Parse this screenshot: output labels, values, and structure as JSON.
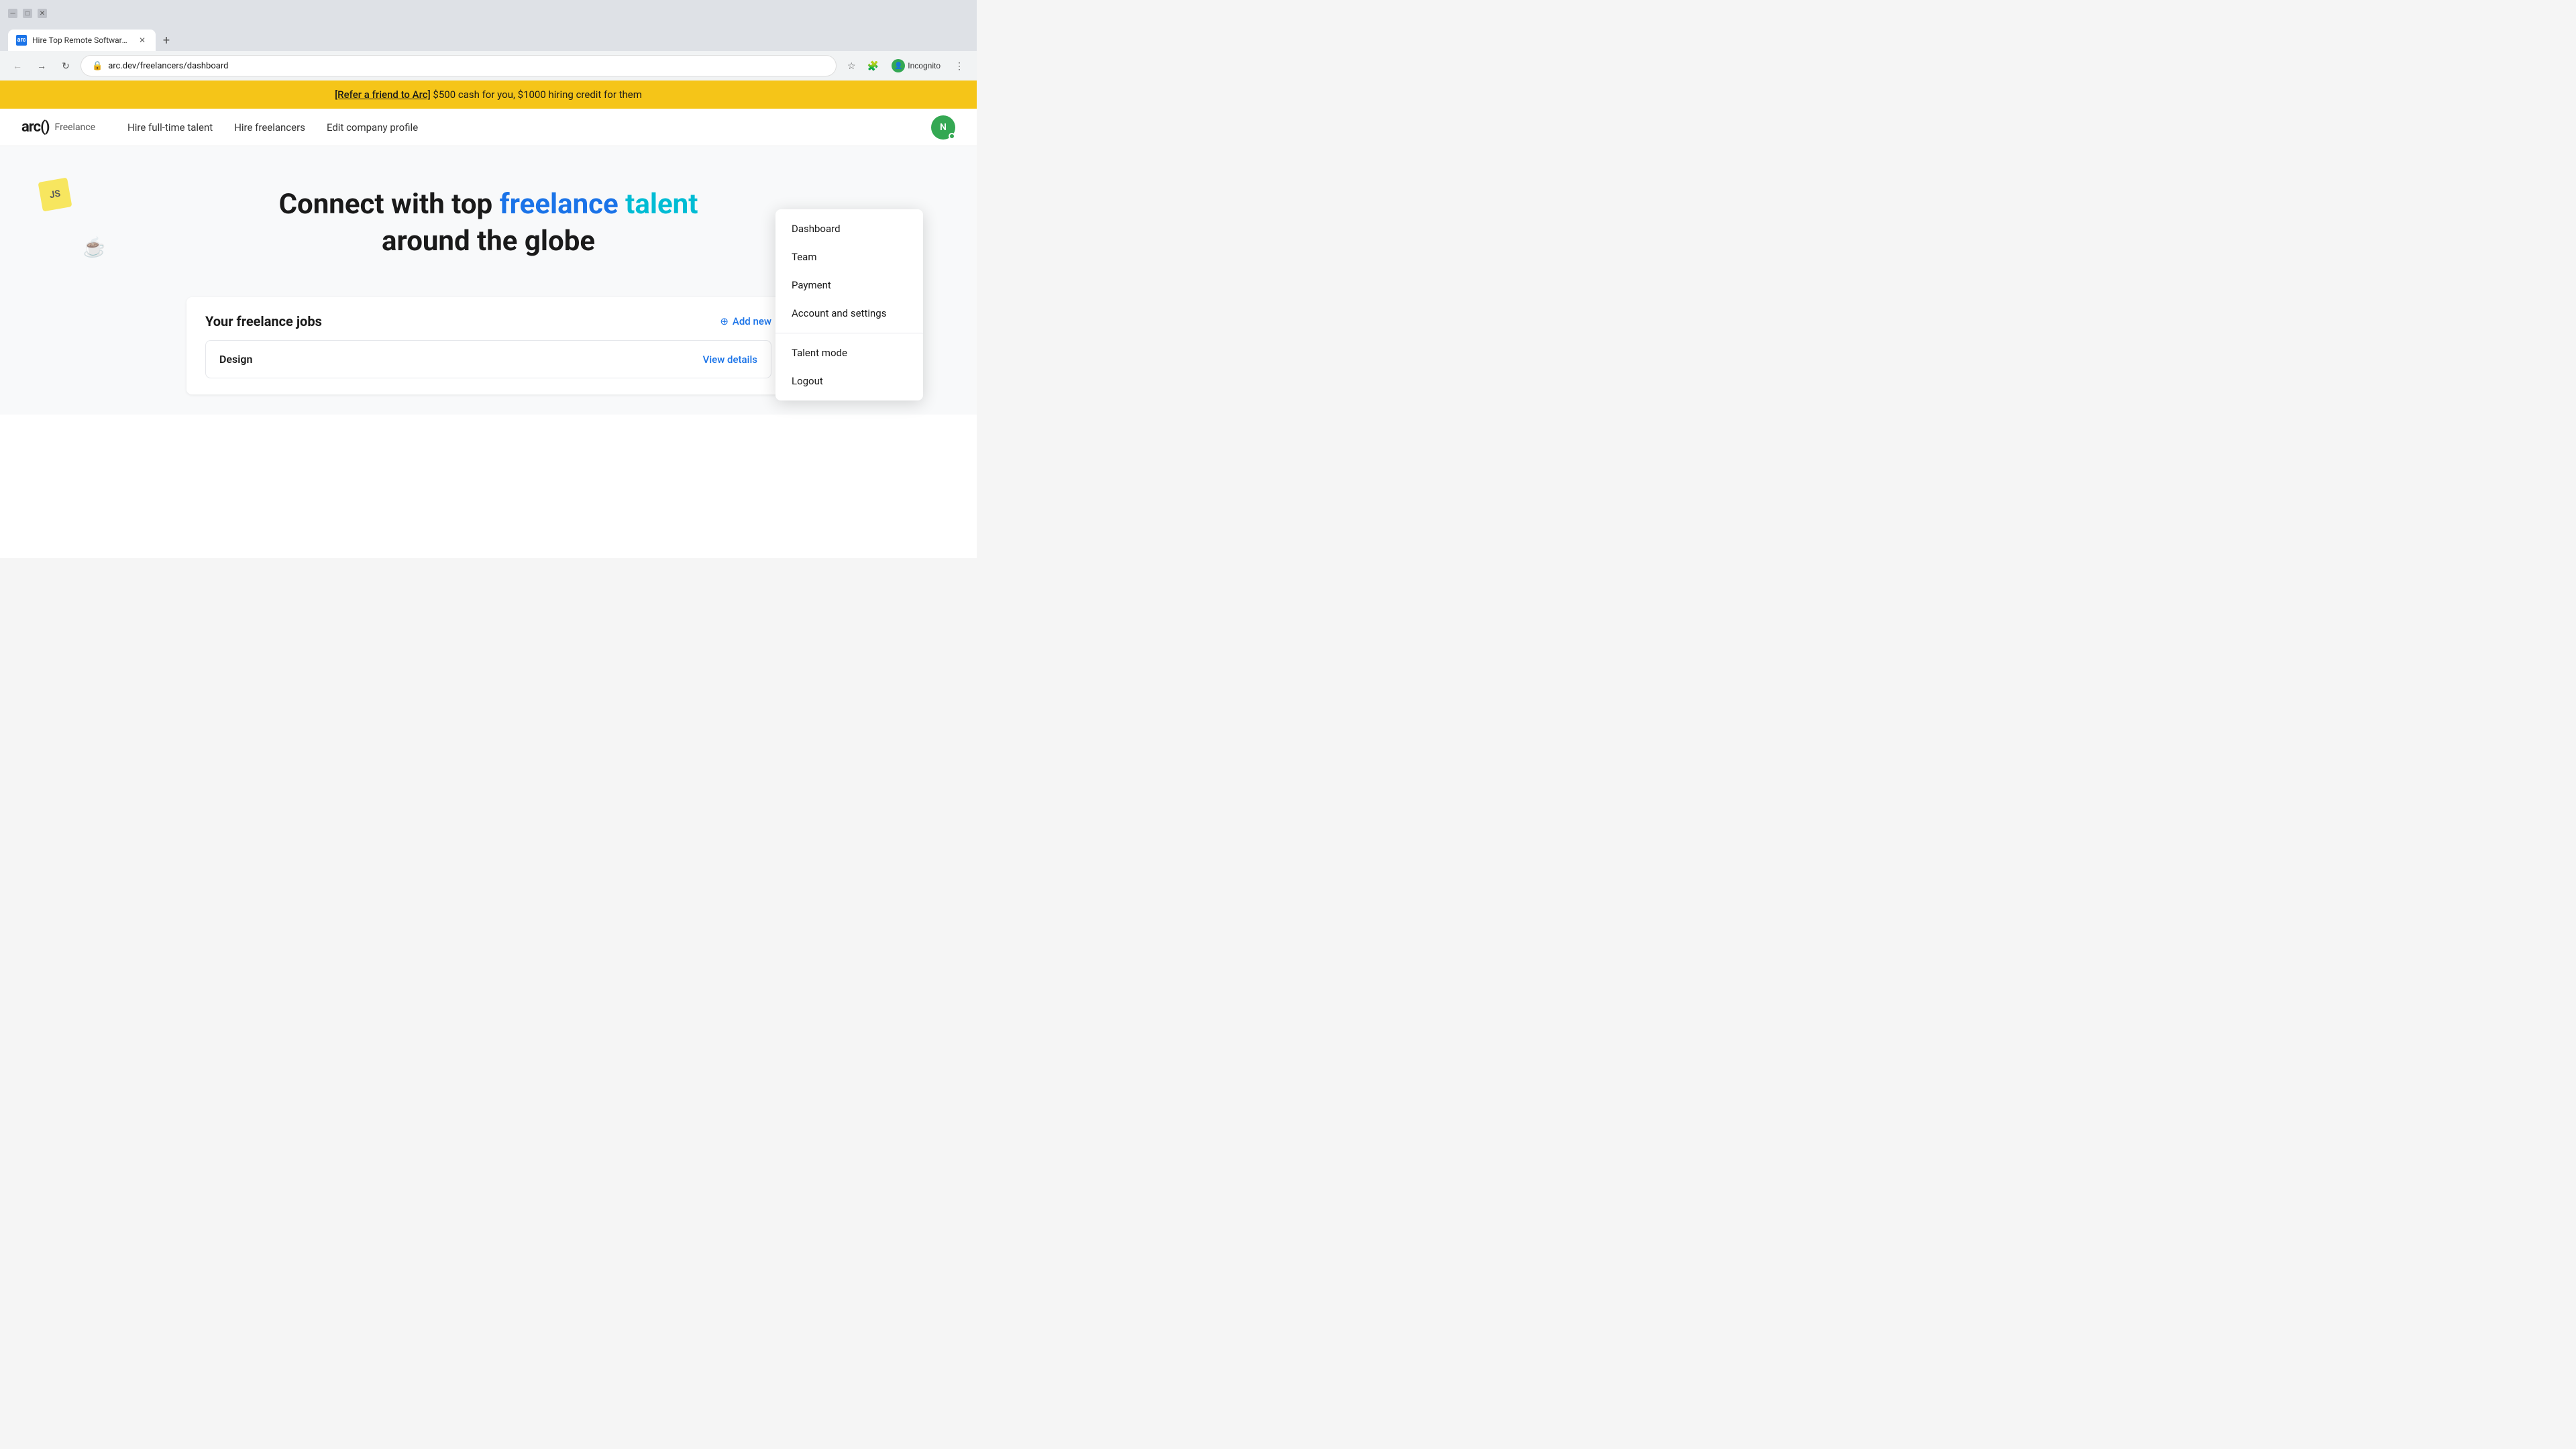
{
  "browser": {
    "tab_title": "Hire Top Remote Software Dev...",
    "tab_favicon": "arc",
    "url": "arc.dev/freelancers/dashboard",
    "new_tab_label": "+",
    "nav": {
      "back_title": "Back",
      "forward_title": "Forward",
      "reload_title": "Reload"
    },
    "incognito_label": "Incognito"
  },
  "banner": {
    "link_text": "[Refer a friend to Arc]",
    "message": " $500 cash for you, $1000 hiring credit for them"
  },
  "site_nav": {
    "logo_text": "arc()",
    "logo_subtitle": "Freelance",
    "links": [
      {
        "label": "Hire full-time talent",
        "id": "hire-fulltime"
      },
      {
        "label": "Hire freelancers",
        "id": "hire-freelancers"
      },
      {
        "label": "Edit company profile",
        "id": "edit-company"
      }
    ]
  },
  "hero": {
    "line1_start": "Connect with top ",
    "line1_highlight1": "freelance",
    "line1_space": " ",
    "line1_highlight2": "talent",
    "line2": "around the globe"
  },
  "jobs_section": {
    "title": "Your freelance jobs",
    "add_new_label": "Add new",
    "add_icon": "⊕",
    "jobs": [
      {
        "name": "Design",
        "view_label": "View details"
      }
    ]
  },
  "dropdown": {
    "items": [
      {
        "label": "Dashboard",
        "id": "dashboard"
      },
      {
        "label": "Team",
        "id": "team"
      },
      {
        "label": "Payment",
        "id": "payment"
      },
      {
        "label": "Account and settings",
        "id": "account-settings"
      },
      {
        "label": "Talent mode",
        "id": "talent-mode"
      },
      {
        "label": "Logout",
        "id": "logout"
      }
    ]
  },
  "float_icons": {
    "js": "JS",
    "java": "☕"
  }
}
